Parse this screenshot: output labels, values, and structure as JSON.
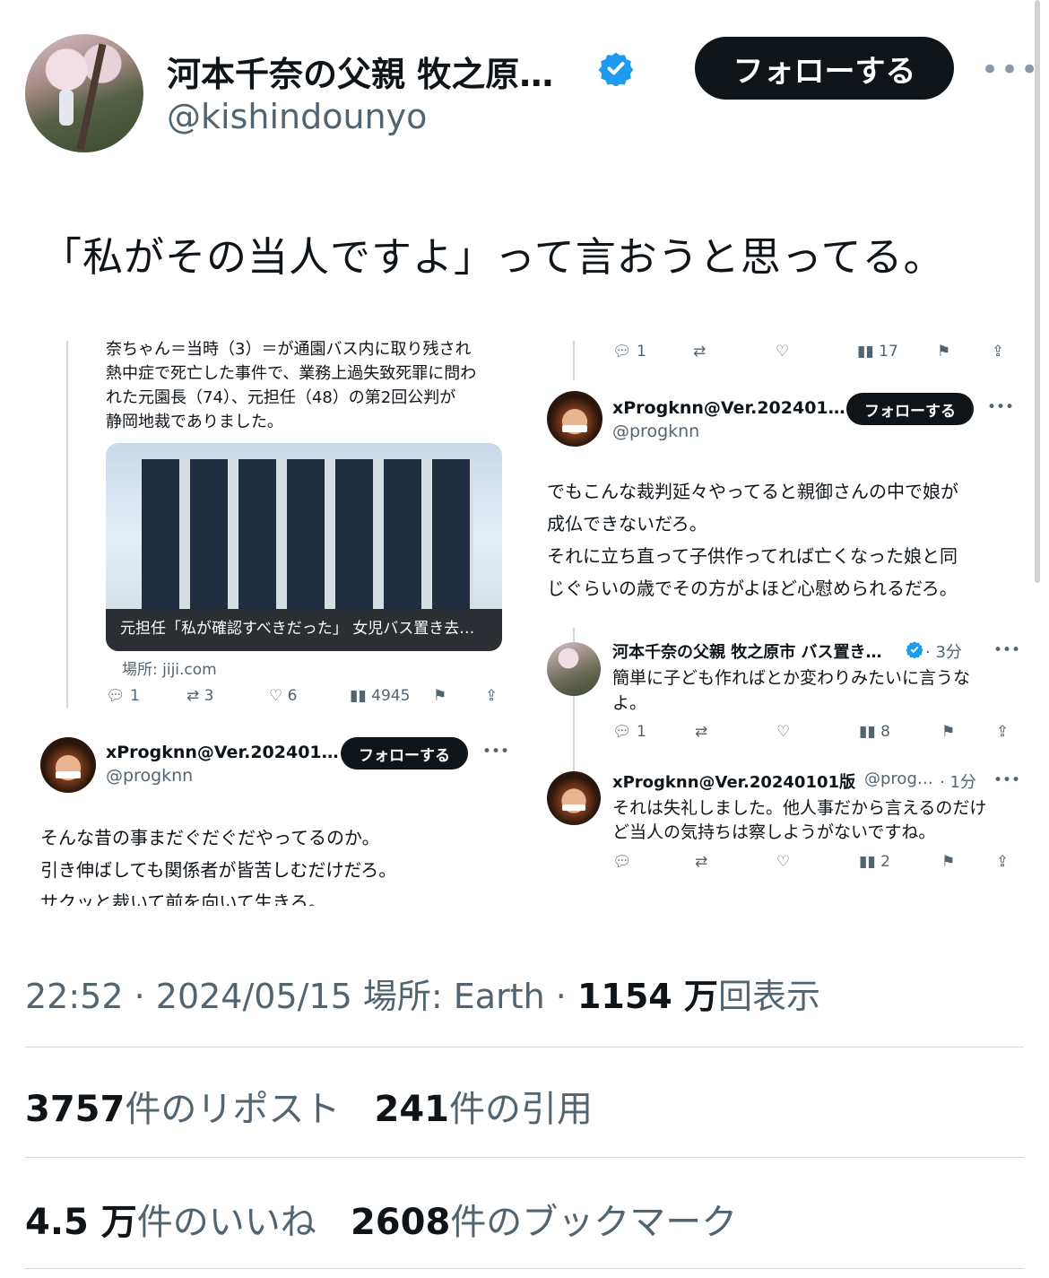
{
  "author": {
    "display_name": "河本千奈の父親 牧之原…",
    "handle": "@kishindounyo",
    "follow_label": "フォローする"
  },
  "tweet": {
    "text": "「私がその当人ですよ」って言おうと思ってる。"
  },
  "embedded": {
    "left": {
      "news_text_1": "奈ちゃん＝当時（3）＝が通園バス内に取り残され",
      "news_text_2": "熱中症で死亡した事件で、業務上過失致死罪に問わ",
      "news_text_3": "れた元園長（74）、元担任（48）の第2回公判が",
      "news_text_4": "静岡地裁でありました。",
      "card_caption": "元担任「私が確認すべきだった」 女児バス置き去…",
      "card_source": "場所: jiji.com",
      "replies": "1",
      "reposts": "3",
      "likes": "6",
      "views": "4945",
      "reply_author_name": "xProgknn@Ver.202401…",
      "reply_author_handle": "@progknn",
      "reply_follow": "フォローする",
      "reply_text_1": "そんな昔の事まだぐだぐだやってるのか。",
      "reply_text_2": "引き伸ばしても関係者が皆苦しむだけだろ。",
      "reply_text_3": "サクッと裁いて前を向いて生きろ。"
    },
    "right": {
      "top_replies": "1",
      "top_views": "17",
      "author_name": "xProgknn@Ver.202401…",
      "author_handle": "@progknn",
      "follow": "フォローする",
      "text_1": "でもこんな裁判延々やってると親御さんの中で娘が",
      "text_2": "成仏できないだろ。",
      "text_3": "それに立ち直って子供作ってれば亡くなった娘と同",
      "text_4": "じぐらいの歳でその方がよほど心慰められるだろ。",
      "reply1_name": "河本千奈の父親 牧之原市 バス置き…",
      "reply1_time": "· 3分",
      "reply1_text_1": "簡単に子ども作ればとか変わりみたいに言うな",
      "reply1_text_2": "よ。",
      "reply1_replies": "1",
      "reply1_views": "8",
      "reply2_name": "xProgknn@Ver.20240101版",
      "reply2_handle": "@prog…",
      "reply2_time": "· 1分",
      "reply2_text_1": "それは失礼しました。他人事だから言えるのだけ",
      "reply2_text_2": "ど当人の気持ちは察しようがないですね。",
      "reply2_views": "2"
    }
  },
  "meta": {
    "time": "22:52",
    "date": "2024/05/15",
    "location": "場所: Earth",
    "views_number": "1154 万",
    "views_label": "回表示"
  },
  "stats": {
    "reposts_number": "3757",
    "reposts_label": "件のリポスト",
    "quotes_number": "241",
    "quotes_label": "件の引用",
    "likes_number": "4.5 万",
    "likes_label": "件のいいね",
    "bookmarks_number": "2608",
    "bookmarks_label": "件のブックマーク"
  },
  "colors": {
    "verified": "#1d9bf0",
    "button_bg": "#0f1419",
    "secondary_text": "#536471"
  },
  "icons": [
    "verified-badge-icon",
    "more-icon",
    "reply-icon",
    "repost-icon",
    "like-icon",
    "views-icon",
    "bookmark-icon",
    "share-icon"
  ]
}
